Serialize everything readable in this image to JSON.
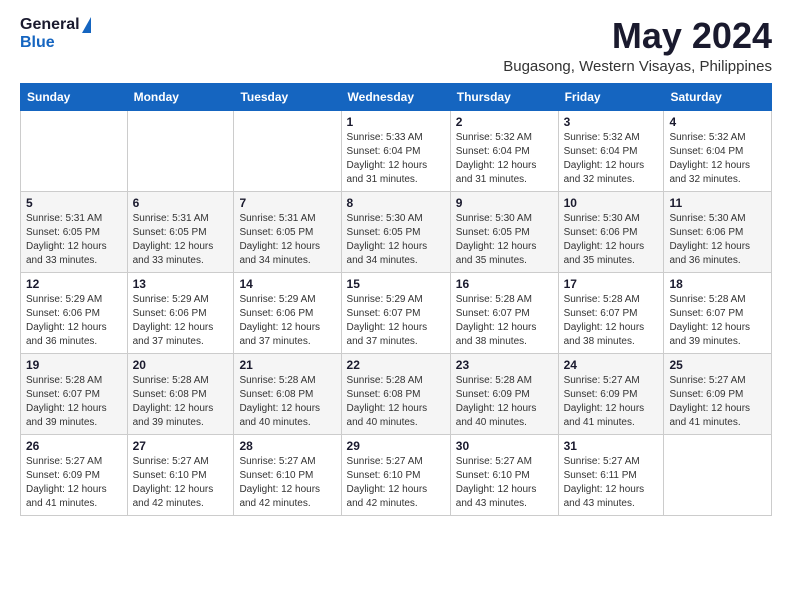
{
  "header": {
    "logo_general": "General",
    "logo_blue": "Blue",
    "month_year": "May 2024",
    "location": "Bugasong, Western Visayas, Philippines"
  },
  "days_of_week": [
    "Sunday",
    "Monday",
    "Tuesday",
    "Wednesday",
    "Thursday",
    "Friday",
    "Saturday"
  ],
  "weeks": [
    [
      {
        "day": "",
        "info": ""
      },
      {
        "day": "",
        "info": ""
      },
      {
        "day": "",
        "info": ""
      },
      {
        "day": "1",
        "info": "Sunrise: 5:33 AM\nSunset: 6:04 PM\nDaylight: 12 hours\nand 31 minutes."
      },
      {
        "day": "2",
        "info": "Sunrise: 5:32 AM\nSunset: 6:04 PM\nDaylight: 12 hours\nand 31 minutes."
      },
      {
        "day": "3",
        "info": "Sunrise: 5:32 AM\nSunset: 6:04 PM\nDaylight: 12 hours\nand 32 minutes."
      },
      {
        "day": "4",
        "info": "Sunrise: 5:32 AM\nSunset: 6:04 PM\nDaylight: 12 hours\nand 32 minutes."
      }
    ],
    [
      {
        "day": "5",
        "info": "Sunrise: 5:31 AM\nSunset: 6:05 PM\nDaylight: 12 hours\nand 33 minutes."
      },
      {
        "day": "6",
        "info": "Sunrise: 5:31 AM\nSunset: 6:05 PM\nDaylight: 12 hours\nand 33 minutes."
      },
      {
        "day": "7",
        "info": "Sunrise: 5:31 AM\nSunset: 6:05 PM\nDaylight: 12 hours\nand 34 minutes."
      },
      {
        "day": "8",
        "info": "Sunrise: 5:30 AM\nSunset: 6:05 PM\nDaylight: 12 hours\nand 34 minutes."
      },
      {
        "day": "9",
        "info": "Sunrise: 5:30 AM\nSunset: 6:05 PM\nDaylight: 12 hours\nand 35 minutes."
      },
      {
        "day": "10",
        "info": "Sunrise: 5:30 AM\nSunset: 6:06 PM\nDaylight: 12 hours\nand 35 minutes."
      },
      {
        "day": "11",
        "info": "Sunrise: 5:30 AM\nSunset: 6:06 PM\nDaylight: 12 hours\nand 36 minutes."
      }
    ],
    [
      {
        "day": "12",
        "info": "Sunrise: 5:29 AM\nSunset: 6:06 PM\nDaylight: 12 hours\nand 36 minutes."
      },
      {
        "day": "13",
        "info": "Sunrise: 5:29 AM\nSunset: 6:06 PM\nDaylight: 12 hours\nand 37 minutes."
      },
      {
        "day": "14",
        "info": "Sunrise: 5:29 AM\nSunset: 6:06 PM\nDaylight: 12 hours\nand 37 minutes."
      },
      {
        "day": "15",
        "info": "Sunrise: 5:29 AM\nSunset: 6:07 PM\nDaylight: 12 hours\nand 37 minutes."
      },
      {
        "day": "16",
        "info": "Sunrise: 5:28 AM\nSunset: 6:07 PM\nDaylight: 12 hours\nand 38 minutes."
      },
      {
        "day": "17",
        "info": "Sunrise: 5:28 AM\nSunset: 6:07 PM\nDaylight: 12 hours\nand 38 minutes."
      },
      {
        "day": "18",
        "info": "Sunrise: 5:28 AM\nSunset: 6:07 PM\nDaylight: 12 hours\nand 39 minutes."
      }
    ],
    [
      {
        "day": "19",
        "info": "Sunrise: 5:28 AM\nSunset: 6:07 PM\nDaylight: 12 hours\nand 39 minutes."
      },
      {
        "day": "20",
        "info": "Sunrise: 5:28 AM\nSunset: 6:08 PM\nDaylight: 12 hours\nand 39 minutes."
      },
      {
        "day": "21",
        "info": "Sunrise: 5:28 AM\nSunset: 6:08 PM\nDaylight: 12 hours\nand 40 minutes."
      },
      {
        "day": "22",
        "info": "Sunrise: 5:28 AM\nSunset: 6:08 PM\nDaylight: 12 hours\nand 40 minutes."
      },
      {
        "day": "23",
        "info": "Sunrise: 5:28 AM\nSunset: 6:09 PM\nDaylight: 12 hours\nand 40 minutes."
      },
      {
        "day": "24",
        "info": "Sunrise: 5:27 AM\nSunset: 6:09 PM\nDaylight: 12 hours\nand 41 minutes."
      },
      {
        "day": "25",
        "info": "Sunrise: 5:27 AM\nSunset: 6:09 PM\nDaylight: 12 hours\nand 41 minutes."
      }
    ],
    [
      {
        "day": "26",
        "info": "Sunrise: 5:27 AM\nSunset: 6:09 PM\nDaylight: 12 hours\nand 41 minutes."
      },
      {
        "day": "27",
        "info": "Sunrise: 5:27 AM\nSunset: 6:10 PM\nDaylight: 12 hours\nand 42 minutes."
      },
      {
        "day": "28",
        "info": "Sunrise: 5:27 AM\nSunset: 6:10 PM\nDaylight: 12 hours\nand 42 minutes."
      },
      {
        "day": "29",
        "info": "Sunrise: 5:27 AM\nSunset: 6:10 PM\nDaylight: 12 hours\nand 42 minutes."
      },
      {
        "day": "30",
        "info": "Sunrise: 5:27 AM\nSunset: 6:10 PM\nDaylight: 12 hours\nand 43 minutes."
      },
      {
        "day": "31",
        "info": "Sunrise: 5:27 AM\nSunset: 6:11 PM\nDaylight: 12 hours\nand 43 minutes."
      },
      {
        "day": "",
        "info": ""
      }
    ]
  ]
}
